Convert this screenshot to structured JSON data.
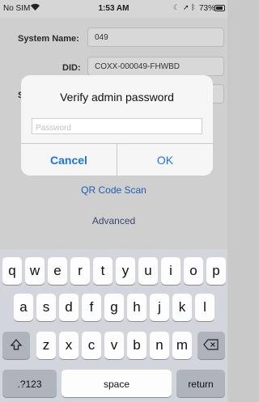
{
  "status_bar": {
    "carrier": "No SIM",
    "time": "1:53 AM",
    "battery": "73%",
    "battery_level": 0.73
  },
  "form": {
    "system_name_label": "System Name:",
    "system_name_value": "049",
    "did_label": "DID:",
    "did_value": "COXX-000049-FHWBD",
    "partial_label": "S"
  },
  "links": {
    "qr_scan": "QR Code Scan",
    "advanced": "Advanced"
  },
  "alert": {
    "title": "Verify admin password",
    "password_placeholder": "Password",
    "cancel_label": "Cancel",
    "ok_label": "OK"
  },
  "keyboard": {
    "row1": [
      "q",
      "w",
      "e",
      "r",
      "t",
      "y",
      "u",
      "i",
      "o",
      "p"
    ],
    "row2": [
      "a",
      "s",
      "d",
      "f",
      "g",
      "h",
      "j",
      "k",
      "l"
    ],
    "row3": [
      "z",
      "x",
      "c",
      "v",
      "b",
      "n",
      "m"
    ],
    "numbers_label": ".?123",
    "space_label": "space",
    "return_label": "return"
  },
  "colors": {
    "accent": "#1a75e8"
  }
}
